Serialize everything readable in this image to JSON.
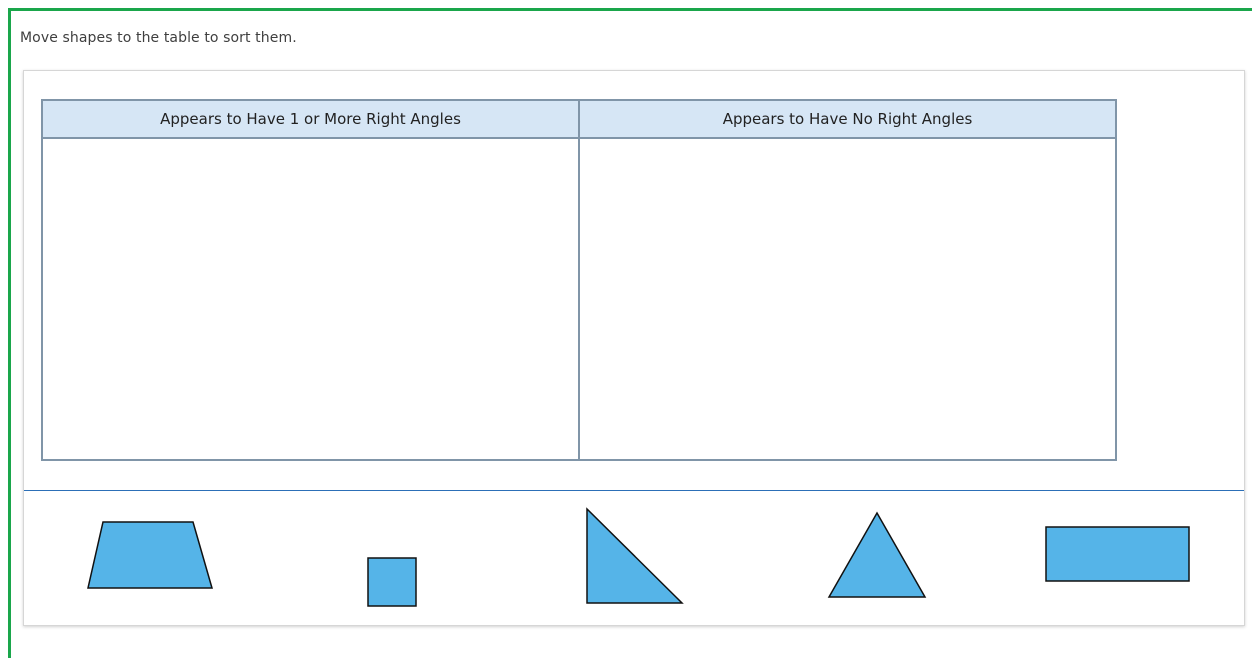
{
  "prompt": "Move shapes to the table to sort them.",
  "table": {
    "columns": [
      {
        "header": "Appears to Have 1 or More Right Angles"
      },
      {
        "header": "Appears to Have No Right Angles"
      }
    ]
  },
  "shapes": [
    {
      "name": "trapezoid",
      "icon": "trapezoid-icon"
    },
    {
      "name": "square",
      "icon": "square-icon"
    },
    {
      "name": "right-triangle",
      "icon": "right-triangle-icon"
    },
    {
      "name": "triangle",
      "icon": "triangle-icon"
    },
    {
      "name": "rectangle",
      "icon": "rectangle-icon"
    }
  ],
  "colors": {
    "frame_border": "#1aa64b",
    "header_fill": "#d6e6f5",
    "table_border": "#8095a8",
    "shape_fill": "#55b4e8",
    "shape_stroke": "#111111",
    "divider": "#2c6fb7"
  }
}
